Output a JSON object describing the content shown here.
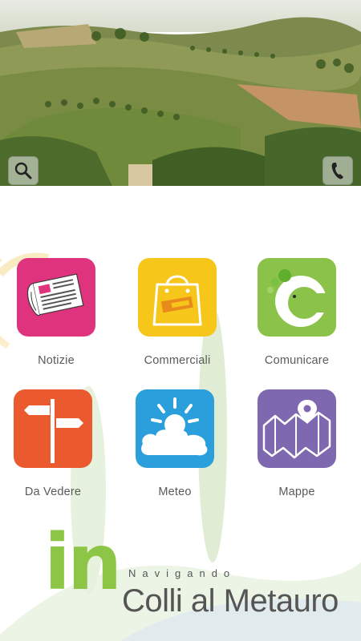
{
  "header": {
    "search_icon": "magnifier-icon",
    "phone_icon": "phone-handset-icon"
  },
  "tiles": [
    {
      "label": "Notizie",
      "color": "#e0337e",
      "icon": "newspaper-icon"
    },
    {
      "label": "Commerciali",
      "color": "#f7c61a",
      "icon": "shopping-bag-icon"
    },
    {
      "label": "Comunicare",
      "color": "#8bc34a",
      "icon": "chat-c-icon"
    },
    {
      "label": "Da Vedere",
      "color": "#ea5a2e",
      "icon": "signpost-icon"
    },
    {
      "label": "Meteo",
      "color": "#2a9fdb",
      "icon": "sun-cloud-icon"
    },
    {
      "label": "Mappe",
      "color": "#7e68b0",
      "icon": "map-pin-icon"
    }
  ],
  "brand": {
    "prefix": "in",
    "subtitle": "Navigando",
    "town": "Colli al Metauro",
    "accent": "#8dc646"
  }
}
